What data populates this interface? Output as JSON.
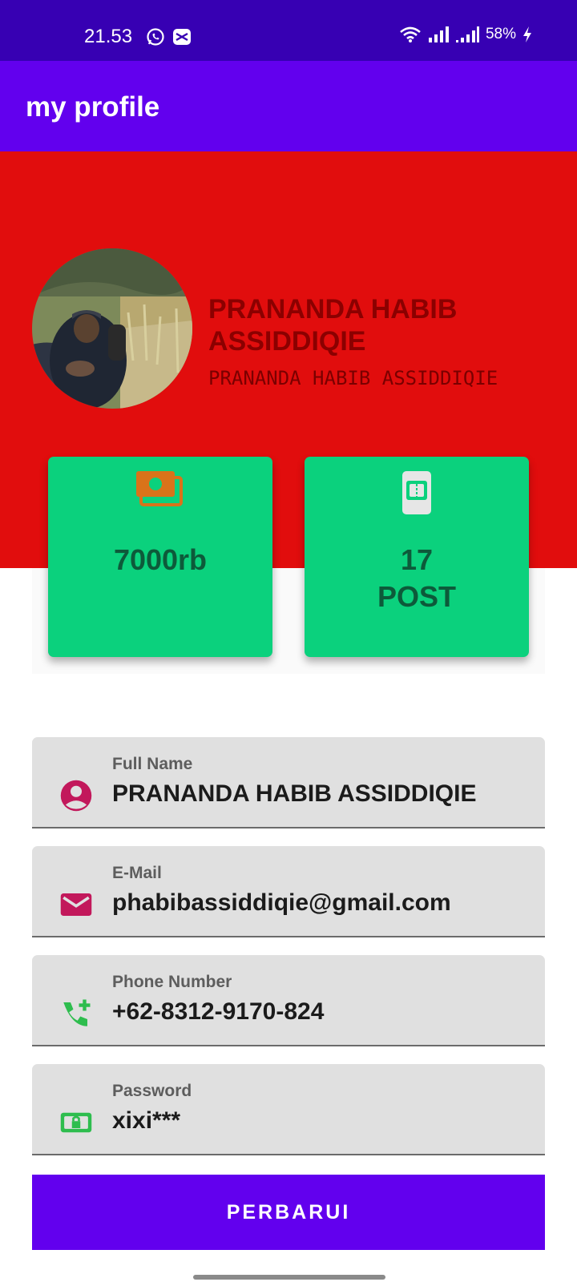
{
  "status_bar": {
    "time": "21.53",
    "battery": "58%"
  },
  "app_bar": {
    "title": "my profile"
  },
  "profile": {
    "name": "PRANANDA HABIB ASSIDDIQIE",
    "subtitle": "PRANANDA HABIB ASSIDDIQIE",
    "avatar_alt": "profile photo"
  },
  "stats": [
    {
      "icon": "money-icon",
      "value": "7000rb"
    },
    {
      "icon": "ticket-icon",
      "value_line1": "17",
      "value_line2": "POST"
    }
  ],
  "form": {
    "fields": [
      {
        "label": "Full Name",
        "value": "PRANANDA HABIB ASSIDDIQIE",
        "icon": "account-circle-icon"
      },
      {
        "label": "E-Mail",
        "value": "phabibassiddiqie@gmail.com",
        "icon": "email-icon"
      },
      {
        "label": "Phone Number",
        "value": "+62-8312-9170-824",
        "icon": "add-call-icon"
      },
      {
        "label": "Password",
        "value": "xixi***",
        "icon": "lock-icon"
      }
    ],
    "submit_label": "PERBARUI"
  },
  "colors": {
    "status_bar": "#3700b3",
    "app_bar": "#6200ee",
    "header": "#e10d0d",
    "card": "#0bd17d",
    "button": "#6200ee"
  }
}
